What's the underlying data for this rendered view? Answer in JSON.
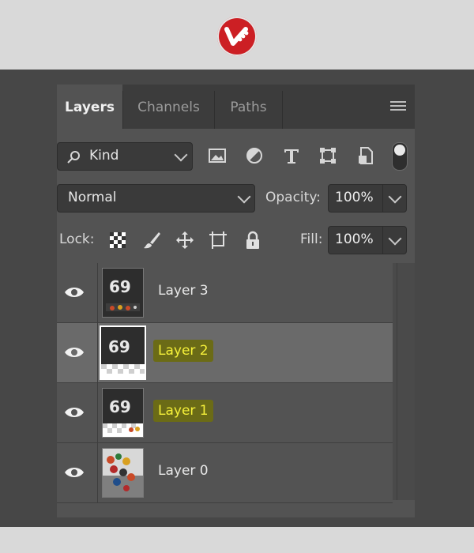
{
  "brand": {
    "logo_icon": "brand-logo-icon",
    "logo_color": "#cc1f24"
  },
  "panel": {
    "tabs": [
      {
        "label": "Layers",
        "active": true
      },
      {
        "label": "Channels",
        "active": false
      },
      {
        "label": "Paths",
        "active": false
      }
    ],
    "menu_icon": "hamburger-menu-icon"
  },
  "filter": {
    "kind_label": "Kind",
    "icons": [
      "image-filter-icon",
      "adjustment-filter-icon",
      "type-filter-icon",
      "shape-filter-icon",
      "smart-object-filter-icon"
    ],
    "toggle": "filter-toggle"
  },
  "blend": {
    "mode": "Normal",
    "opacity_label": "Opacity:",
    "opacity_value": "100%"
  },
  "lock": {
    "label": "Lock:",
    "icons": [
      "lock-transparent-icon",
      "lock-paint-icon",
      "lock-position-icon",
      "lock-artboard-icon",
      "lock-all-icon"
    ],
    "fill_label": "Fill:",
    "fill_value": "100%"
  },
  "layers": [
    {
      "name": "Layer 3",
      "selected": false,
      "highlighted": false,
      "visible": true
    },
    {
      "name": "Layer 2",
      "selected": true,
      "highlighted": true,
      "visible": true
    },
    {
      "name": "Layer 1",
      "selected": false,
      "highlighted": true,
      "visible": true
    },
    {
      "name": "Layer 0",
      "selected": false,
      "highlighted": false,
      "visible": true
    }
  ],
  "colors": {
    "panel_bg": "#535353",
    "selected_row": "#6a6a6a",
    "highlight_text": "#f5f03a"
  }
}
